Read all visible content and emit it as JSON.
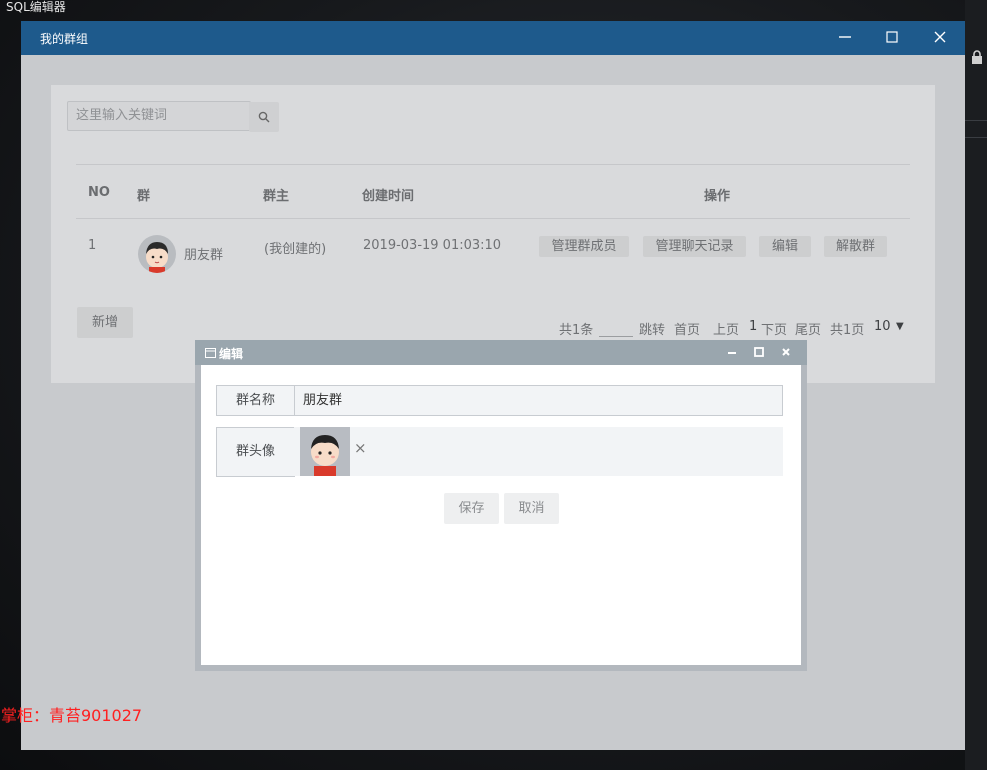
{
  "desktop": {
    "app_title": "SQL编辑器",
    "overlay_text": "掌柜：青苔901027"
  },
  "window": {
    "title": "我的群组",
    "controls": [
      "minimize-icon",
      "maximize-icon",
      "close-icon"
    ]
  },
  "search": {
    "placeholder": "这里输入关键词"
  },
  "table": {
    "headers": [
      "NO",
      "群",
      "群主",
      "创建时间",
      "操作"
    ],
    "rows": [
      {
        "no": "1",
        "group": "朋友群",
        "owner": "(我创建的)",
        "created": "2019-03-19 01:03:10",
        "actions": [
          "管理群成员",
          "管理聊天记录",
          "编辑",
          "解散群"
        ]
      }
    ]
  },
  "add_button": "新增",
  "pager": {
    "total": "共1条",
    "jump": "跳转",
    "first": "首页",
    "prev": "上页",
    "current": "1",
    "next": "下页",
    "last": "尾页",
    "pages": "共1页",
    "page_size": "10",
    "dropdown_arrow": "▼"
  },
  "dialog": {
    "title": "编辑",
    "name_label": "群名称",
    "name_value": "朋友群",
    "avatar_label": "群头像",
    "remove_icon": "×",
    "save": "保存",
    "cancel": "取消"
  }
}
